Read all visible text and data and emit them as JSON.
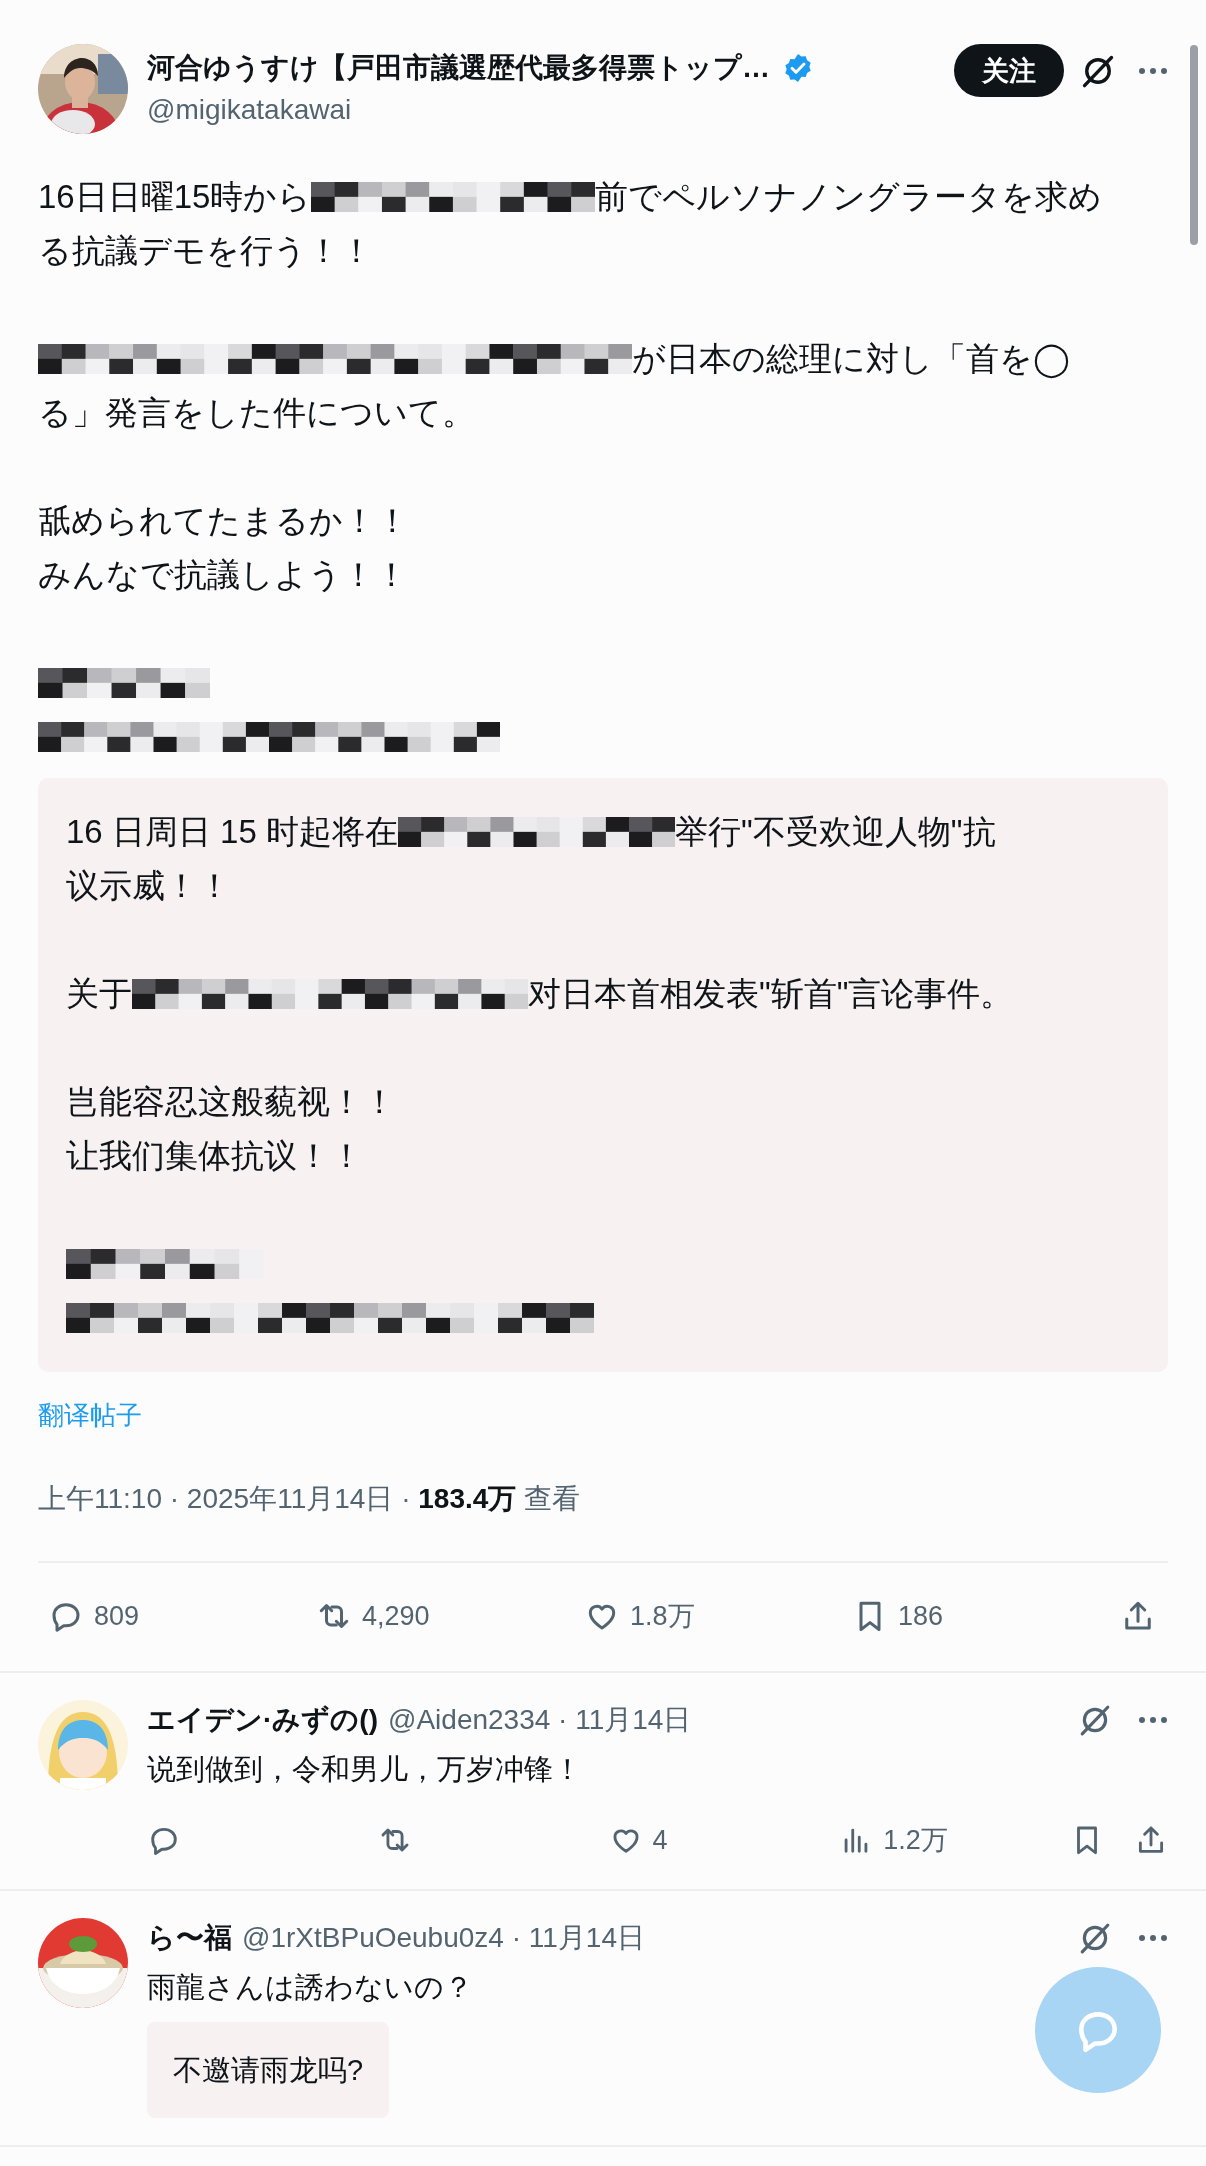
{
  "post": {
    "author": {
      "name": "河合ゆうすけ【戸田市議選歴代最多得票トップ…",
      "verified": true,
      "handle": "@migikatakawai"
    },
    "follow_button": "关注",
    "body": [
      [
        [
          {
            "kind": "text",
            "text": "16日日曜15時から"
          },
          {
            "kind": "redacted"
          },
          {
            "kind": "text",
            "text": "前でペルソナノングラータを求め"
          }
        ],
        [
          {
            "kind": "text",
            "text": "る抗議デモを行う！！"
          }
        ]
      ],
      [
        [
          {
            "kind": "redacted"
          },
          {
            "kind": "text",
            "text": "が日本の総理に対し「首を◯"
          }
        ],
        [
          {
            "kind": "text",
            "text": "る」発言をした件について。"
          }
        ]
      ],
      [
        [
          {
            "kind": "text",
            "text": "舐められてたまるか！！"
          }
        ],
        [
          {
            "kind": "text",
            "text": "みんなで抗議しよう！！"
          }
        ]
      ],
      [
        [
          {
            "kind": "redacted"
          }
        ],
        [
          {
            "kind": "redacted"
          }
        ]
      ]
    ],
    "translation": [
      [
        [
          {
            "kind": "text",
            "text": "16 日周日 15 时起将在"
          },
          {
            "kind": "redacted"
          },
          {
            "kind": "text",
            "text": "举行\"不受欢迎人物\"抗"
          }
        ],
        [
          {
            "kind": "text",
            "text": "议示威！！"
          }
        ]
      ],
      [
        [
          {
            "kind": "text",
            "text": "关于"
          },
          {
            "kind": "redacted"
          },
          {
            "kind": "text",
            "text": "对日本首相发表\"斩首\"言论事件。"
          }
        ]
      ],
      [
        [
          {
            "kind": "text",
            "text": "岂能容忍这般藐视！！"
          }
        ],
        [
          {
            "kind": "text",
            "text": "让我们集体抗议！！"
          }
        ]
      ],
      [
        [
          {
            "kind": "redacted"
          }
        ],
        [
          {
            "kind": "redacted"
          }
        ]
      ]
    ],
    "translate_link": "翻译帖子",
    "meta": "上午11:10 · 2025年11月14日 · **183.4万** 查看",
    "actions": [
      {
        "kind": "reply",
        "count": "809"
      },
      {
        "kind": "repost",
        "count": "4,290"
      },
      {
        "kind": "like",
        "count": "1.8万"
      },
      {
        "kind": "bookmark",
        "count": "186"
      },
      {
        "kind": "share"
      }
    ]
  },
  "replies": [
    {
      "name": "エイデン·みずの()",
      "handle_line": "@Aiden2334 · 11月14日",
      "text": "说到做到，令和男儿，万岁冲锋！",
      "actions": [
        {
          "kind": "reply"
        },
        {
          "kind": "repost"
        },
        {
          "kind": "like",
          "count": "4"
        },
        {
          "kind": "views",
          "count": "1.2万"
        },
        {
          "kind": "bookmark"
        },
        {
          "kind": "share"
        }
      ]
    },
    {
      "name": "ら〜福",
      "handle_line": "@1rXtBPuOeubu0z4 · 11月14日",
      "text": "雨龍さんは誘わないの？",
      "translation": "不邀请雨龙吗?"
    }
  ]
}
